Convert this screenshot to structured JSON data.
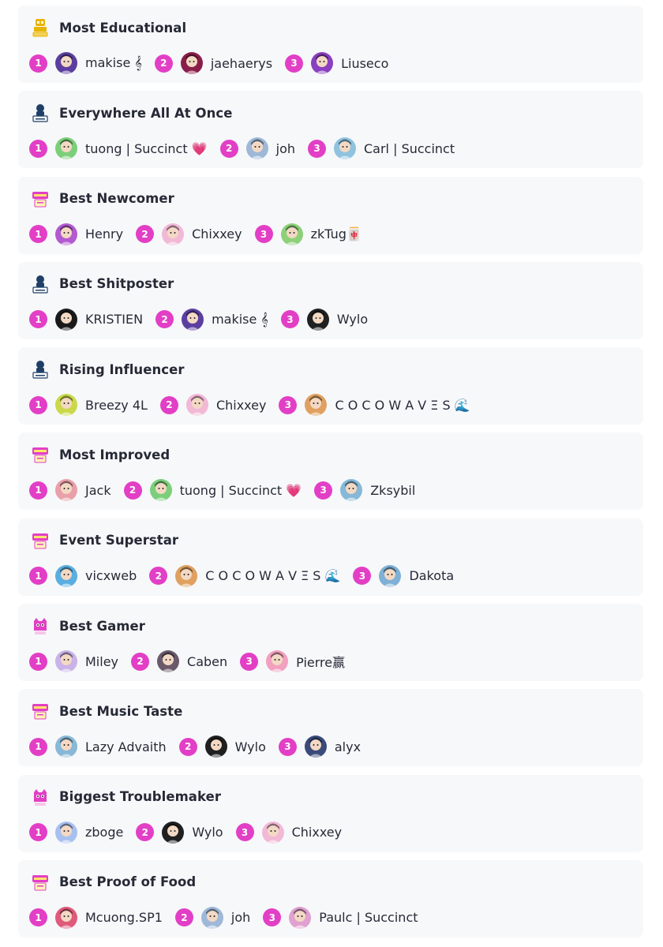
{
  "categories": [
    {
      "title": "Most Educational",
      "icon": "robot-trophy-icon",
      "icon_color": "#e8b400",
      "winners": [
        {
          "rank": "1",
          "name": "makise 𝄞",
          "avatar_color": "#5b3fa0"
        },
        {
          "rank": "2",
          "name": "jaehaerys",
          "avatar_color": "#8a1e4a"
        },
        {
          "rank": "3",
          "name": "Liuseco",
          "avatar_color": "#8a3fc0"
        }
      ]
    },
    {
      "title": "Everywhere All At Once",
      "icon": "robot-badge-icon",
      "icon_color": "#1f3f66",
      "winners": [
        {
          "rank": "1",
          "name": "tuong | Succinct 💗",
          "avatar_color": "#7ccf7a"
        },
        {
          "rank": "2",
          "name": "joh",
          "avatar_color": "#9fb8d8"
        },
        {
          "rank": "3",
          "name": "Carl | Succinct",
          "avatar_color": "#8fc3e0"
        }
      ]
    },
    {
      "title": "Best Newcomer",
      "icon": "prove-badge-icon",
      "icon_color": "#e23fc6",
      "winners": [
        {
          "rank": "1",
          "name": "Henry",
          "avatar_color": "#b35ad0"
        },
        {
          "rank": "2",
          "name": "Chixxey",
          "avatar_color": "#f2b9d6"
        },
        {
          "rank": "3",
          "name": "zkTug🀄",
          "avatar_color": "#8ed07a"
        }
      ]
    },
    {
      "title": "Best Shitposter",
      "icon": "robot-badge-icon",
      "icon_color": "#1f3f66",
      "winners": [
        {
          "rank": "1",
          "name": "KRISTIEN",
          "avatar_color": "#1a1a1a"
        },
        {
          "rank": "2",
          "name": "makise 𝄞",
          "avatar_color": "#5b3fa0"
        },
        {
          "rank": "3",
          "name": "Wylo",
          "avatar_color": "#202020"
        }
      ]
    },
    {
      "title": "Rising Influencer",
      "icon": "robot-badge-icon",
      "icon_color": "#1f3f66",
      "winners": [
        {
          "rank": "1",
          "name": "Breezy 4L",
          "avatar_color": "#c9d94a"
        },
        {
          "rank": "2",
          "name": "Chixxey",
          "avatar_color": "#f2b9d6"
        },
        {
          "rank": "3",
          "name": "C O C O  W A V Ξ S 🌊",
          "avatar_color": "#e0a060"
        }
      ]
    },
    {
      "title": "Most Improved",
      "icon": "prove-badge-icon",
      "icon_color": "#e23fc6",
      "winners": [
        {
          "rank": "1",
          "name": "Jack",
          "avatar_color": "#e9a0a8"
        },
        {
          "rank": "2",
          "name": "tuong | Succinct 💗",
          "avatar_color": "#7ccf7a"
        },
        {
          "rank": "3",
          "name": "Zksybil",
          "avatar_color": "#86b8d8"
        }
      ]
    },
    {
      "title": "Event Superstar",
      "icon": "prove-badge-icon",
      "icon_color": "#e23fc6",
      "winners": [
        {
          "rank": "1",
          "name": "vicxweb",
          "avatar_color": "#5aaee0"
        },
        {
          "rank": "2",
          "name": "C O C O  W A V Ξ S 🌊",
          "avatar_color": "#e0a060"
        },
        {
          "rank": "3",
          "name": "Dakota",
          "avatar_color": "#7fb0d6"
        }
      ]
    },
    {
      "title": "Best Gamer",
      "icon": "pink-monster-icon",
      "icon_color": "#e23fc6",
      "winners": [
        {
          "rank": "1",
          "name": "Miley",
          "avatar_color": "#c9b3e8"
        },
        {
          "rank": "2",
          "name": "Caben",
          "avatar_color": "#6a5a6a"
        },
        {
          "rank": "3",
          "name": "Pierre赢",
          "avatar_color": "#f2a0c0"
        }
      ]
    },
    {
      "title": "Best Music Taste",
      "icon": "prove-badge-icon",
      "icon_color": "#e23fc6",
      "winners": [
        {
          "rank": "1",
          "name": "Lazy Advaith",
          "avatar_color": "#88b8d8"
        },
        {
          "rank": "2",
          "name": "Wylo",
          "avatar_color": "#202020"
        },
        {
          "rank": "3",
          "name": "alyx",
          "avatar_color": "#3a4a7a"
        }
      ]
    },
    {
      "title": "Biggest Troublemaker",
      "icon": "pink-monster-icon",
      "icon_color": "#e23fc6",
      "winners": [
        {
          "rank": "1",
          "name": "zboge",
          "avatar_color": "#a8c0f0"
        },
        {
          "rank": "2",
          "name": "Wylo",
          "avatar_color": "#202020"
        },
        {
          "rank": "3",
          "name": "Chixxey",
          "avatar_color": "#f2b9d6"
        }
      ]
    },
    {
      "title": "Best Proof of Food",
      "icon": "prove-badge-icon",
      "icon_color": "#e23fc6",
      "winners": [
        {
          "rank": "1",
          "name": "Mcuong.SP1",
          "avatar_color": "#e05a7a"
        },
        {
          "rank": "2",
          "name": "joh",
          "avatar_color": "#9fb8d8"
        },
        {
          "rank": "3",
          "name": "Paulc | Succinct",
          "avatar_color": "#e0a0d0"
        }
      ]
    }
  ]
}
